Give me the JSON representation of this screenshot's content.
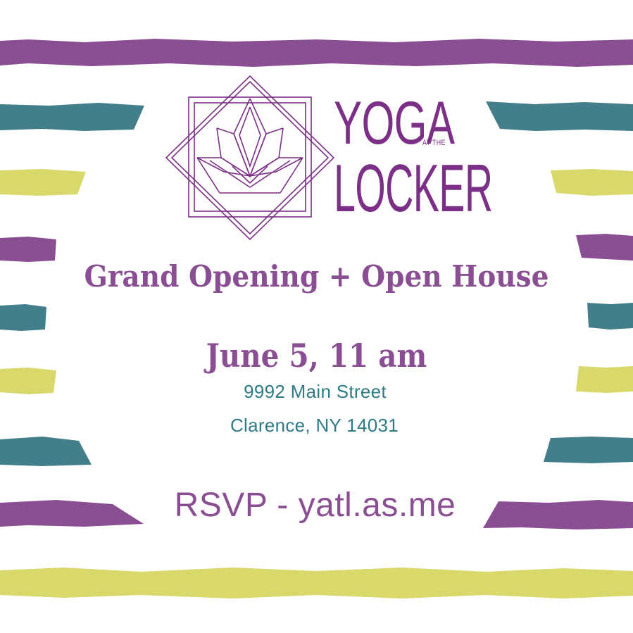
{
  "brand": {
    "yoga": "YOGA",
    "at_the": "AT THE",
    "locker": "LOCKER"
  },
  "event": {
    "headline": "Grand Opening + Open House",
    "date_time": "June 5, 11 am",
    "address_street": "9992 Main Street",
    "address_city": "Clarence, NY 14031",
    "rsvp": "RSVP - yatl.as.me"
  },
  "colors": {
    "purple": "#8a4f92",
    "logo_purple": "#7b2f86",
    "teal": "#2e7b86",
    "stripe_teal": "#437f8b",
    "stripe_yellow": "#d9d86b",
    "background": "#ffffff"
  },
  "icons": {
    "logo_mark": "lotus-diamond-icon"
  }
}
